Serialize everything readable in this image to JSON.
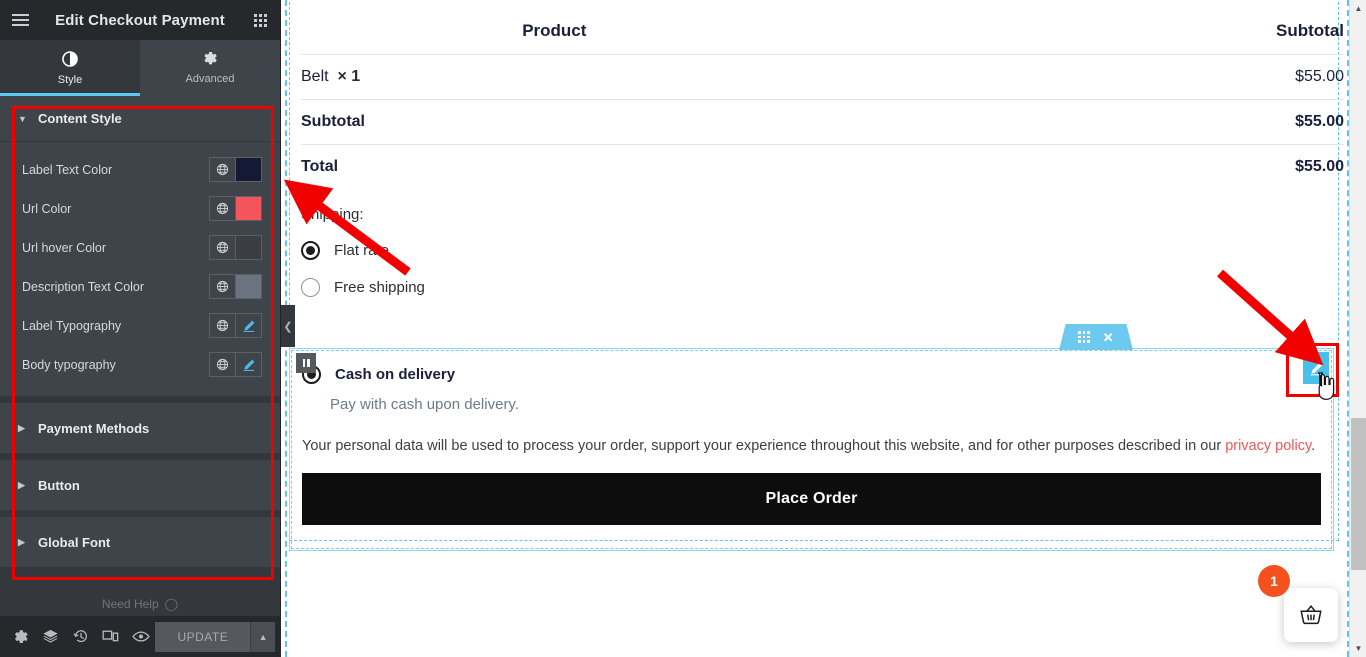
{
  "panel": {
    "title": "Edit Checkout Payment",
    "hamburger_icon": "menu-icon",
    "grid_icon": "apps-grid-icon",
    "tabs": [
      {
        "label": "Style",
        "icon": "contrast-half-circle-icon",
        "active": true
      },
      {
        "label": "Advanced",
        "icon": "gear-icon",
        "active": false
      }
    ],
    "sections": [
      {
        "label": "Content Style",
        "expanded": true,
        "controls": [
          {
            "label": "Label Text Color",
            "type": "color",
            "value": "#141a33",
            "global_icon": "globe-icon"
          },
          {
            "label": "Url Color",
            "type": "color",
            "value": "#f4555c",
            "global_icon": "globe-icon"
          },
          {
            "label": "Url hover Color",
            "type": "color",
            "value": "#3a3e43",
            "global_icon": "globe-icon"
          },
          {
            "label": "Description Text Color",
            "type": "color",
            "value": "#6b7280",
            "global_icon": "globe-icon"
          },
          {
            "label": "Label Typography",
            "type": "typography",
            "global_icon": "globe-icon",
            "edit_icon": "pencil-icon"
          },
          {
            "label": "Body typography",
            "type": "typography",
            "global_icon": "globe-icon",
            "edit_icon": "pencil-icon"
          }
        ]
      },
      {
        "label": "Payment Methods",
        "expanded": false,
        "controls": []
      },
      {
        "label": "Button",
        "expanded": false,
        "controls": []
      },
      {
        "label": "Global Font",
        "expanded": false,
        "controls": []
      }
    ],
    "footer": {
      "icons": [
        {
          "name": "settings-gear-icon"
        },
        {
          "name": "navigator-layers-icon"
        },
        {
          "name": "history-revisions-icon"
        },
        {
          "name": "responsive-preview-icon"
        },
        {
          "name": "preview-eye-icon"
        }
      ],
      "update_label": "UPDATE",
      "update_caret_icon": "chevron-up-icon"
    },
    "collapse_handle_icon": "chevron-left-icon",
    "highlight_color": "#f10000"
  },
  "canvas": {
    "order_table": {
      "headers": [
        "Product",
        "Subtotal"
      ],
      "rows": [
        {
          "name": "Belt",
          "qty": "× 1",
          "subtotal": "$55.00"
        }
      ],
      "totals": [
        {
          "label": "Subtotal",
          "value": "$55.00"
        },
        {
          "label": "Total",
          "value": "$55.00"
        }
      ]
    },
    "shipping": {
      "title": "Shipping:",
      "options": [
        {
          "label": "Flat rate",
          "selected": true
        },
        {
          "label": "Free shipping",
          "selected": false
        }
      ]
    },
    "payment": {
      "method_label": "Cash on delivery",
      "method_selected": true,
      "method_description": "Pay with cash upon delivery.",
      "privacy_text_before": "Your personal data will be used to process your order, support your experience throughout this website, and for other purposes described in our ",
      "privacy_link": "privacy policy",
      "privacy_text_after": ".",
      "place_order_label": "Place Order"
    },
    "widget_toolbar": {
      "drag_icon": "drag-dots-icon",
      "close_icon": "close-x-icon"
    },
    "column_handle_icon": "column-handle-icon",
    "edit_pencil_icon": "pencil-edit-icon",
    "cart": {
      "icon": "shopping-basket-icon",
      "badge_count": "1"
    },
    "scrollbar": {
      "up_icon": "scroll-up-arrow-icon",
      "down_icon": "scroll-down-arrow-icon"
    },
    "accent_blue": "#61c6ef",
    "link_red": "#f2555a"
  },
  "annotations": {
    "arrow_color": "#f10000",
    "arrows": [
      "arrow-pointing-to-panel",
      "arrow-pointing-to-edit-button"
    ]
  }
}
